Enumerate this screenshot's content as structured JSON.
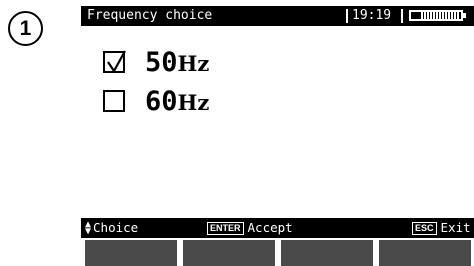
{
  "step_number": "1",
  "titlebar": {
    "title": "Frequency choice",
    "time": "19:19",
    "battery_level": 1.0
  },
  "options": [
    {
      "value": "50",
      "unit": "Hz",
      "checked": true
    },
    {
      "value": "60",
      "unit": "Hz",
      "checked": false
    }
  ],
  "hints": {
    "choice": "Choice",
    "enter_key": "ENTER",
    "accept": "Accept",
    "esc_key": "ESC",
    "exit": "Exit"
  },
  "colors": {
    "bar": "#000000",
    "soft_button": "#4a4a4a",
    "screen": "#ffffff"
  }
}
